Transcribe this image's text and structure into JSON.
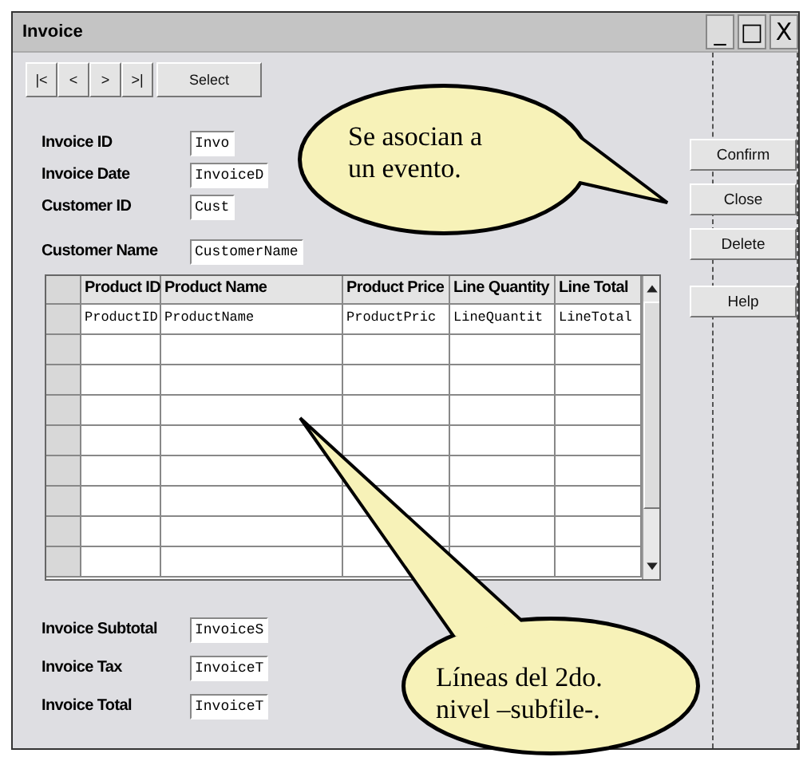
{
  "window": {
    "title": "Invoice",
    "controls": [
      "_",
      "□",
      "X"
    ]
  },
  "navigation": {
    "buttons": [
      "|<",
      "<",
      ">",
      ">|"
    ],
    "select": "Select"
  },
  "header_fields": [
    {
      "label": "Invoice ID",
      "value": "Invo"
    },
    {
      "label": "Invoice Date",
      "value": "InvoiceD"
    },
    {
      "label": "Customer ID",
      "value": "Cust"
    },
    {
      "label": "Customer Name",
      "value": "CustomerName"
    }
  ],
  "grid": {
    "columns": [
      "Product ID",
      "Product Name",
      "Product Price",
      "Line Quantity",
      "Line Total"
    ],
    "rows": [
      [
        "ProductID",
        "ProductName",
        "ProductPric",
        "LineQuantit",
        "LineTotal"
      ]
    ]
  },
  "totals_fields": [
    {
      "label": "Invoice Subtotal",
      "value": "InvoiceS"
    },
    {
      "label": "Invoice Tax",
      "value": "InvoiceT"
    },
    {
      "label": "Invoice Total",
      "value": "InvoiceT"
    }
  ],
  "actions": [
    "Confirm",
    "Close",
    "Delete",
    "Help"
  ],
  "callouts": [
    {
      "lines": [
        "Se asocian a",
        "un evento."
      ]
    },
    {
      "lines": [
        "Líneas del 2do.",
        "nivel –subfile-."
      ]
    }
  ]
}
